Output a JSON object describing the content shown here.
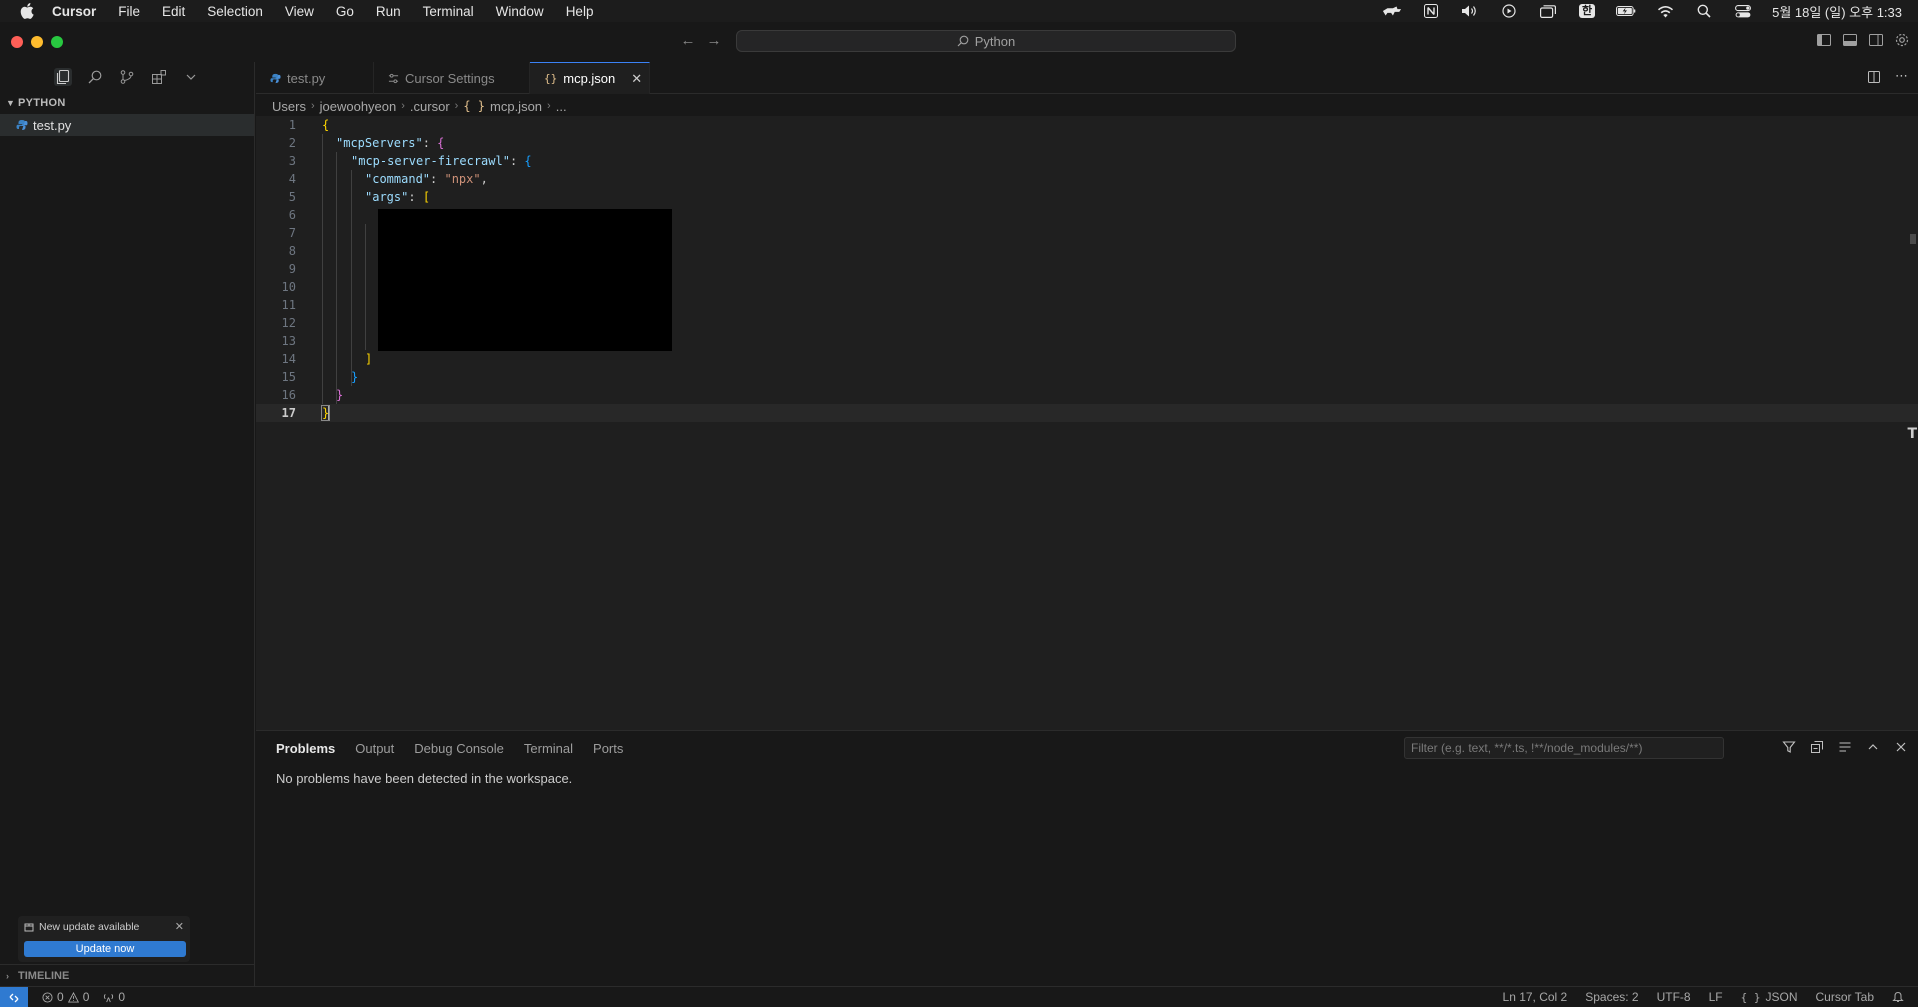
{
  "menubar": {
    "app_name": "Cursor",
    "items": [
      "File",
      "Edit",
      "Selection",
      "View",
      "Go",
      "Run",
      "Terminal",
      "Window",
      "Help"
    ],
    "input_indicator": "한",
    "clock": "5월 18일 (일) 오후 1:33"
  },
  "titlebar": {
    "command_center": "Python"
  },
  "sidebar": {
    "section_title": "PYTHON",
    "files": [
      "test.py"
    ],
    "timeline_title": "TIMELINE"
  },
  "update_toast": {
    "title": "New update available",
    "button": "Update now"
  },
  "tabs": [
    {
      "label": "test.py",
      "icon": "python-icon",
      "active": false
    },
    {
      "label": "Cursor Settings",
      "icon": "settings-icon",
      "active": false
    },
    {
      "label": "mcp.json",
      "icon": "json-icon",
      "active": true
    }
  ],
  "breadcrumb": {
    "parts": [
      "Users",
      "joewoohyeon",
      ".cursor",
      "mcp.json",
      "..."
    ],
    "json_icon": "{ }"
  },
  "editor": {
    "line_numbers": [
      "1",
      "2",
      "3",
      "4",
      "5",
      "6",
      "7",
      "8",
      "9",
      "10",
      "11",
      "12",
      "13",
      "14",
      "15",
      "16",
      "17"
    ],
    "current_line": 17,
    "code": {
      "l1_brace": "{",
      "l2_key": "\"mcpServers\"",
      "l2_rest": ": ",
      "l2_brace": "{",
      "l3_key": "\"mcp-server-firecrawl\"",
      "l3_rest": ": ",
      "l3_brace": "{",
      "l4_key": "\"command\"",
      "l4_colon": ": ",
      "l4_val": "\"npx\"",
      "l4_comma": ",",
      "l5_key": "\"args\"",
      "l5_colon": ": ",
      "l5_bracket": "[",
      "l14_bracket": "]",
      "l15_brace": "}",
      "l16_brace": "}",
      "l17_brace": "}"
    }
  },
  "panel": {
    "tabs": [
      "Problems",
      "Output",
      "Debug Console",
      "Terminal",
      "Ports"
    ],
    "active_tab": "Problems",
    "filter_placeholder": "Filter (e.g. text, **/*.ts, !**/node_modules/**)",
    "message": "No problems have been detected in the workspace."
  },
  "statusbar": {
    "errors": "0",
    "warnings": "0",
    "ports": "0",
    "position": "Ln 17, Col 2",
    "spaces": "Spaces: 2",
    "encoding": "UTF-8",
    "eol": "LF",
    "language": "JSON",
    "cursor_tab": "Cursor Tab"
  },
  "colors": {
    "accent": "#2f7ad1",
    "editor_bg": "#1f1f1f",
    "chrome_bg": "#181818"
  }
}
